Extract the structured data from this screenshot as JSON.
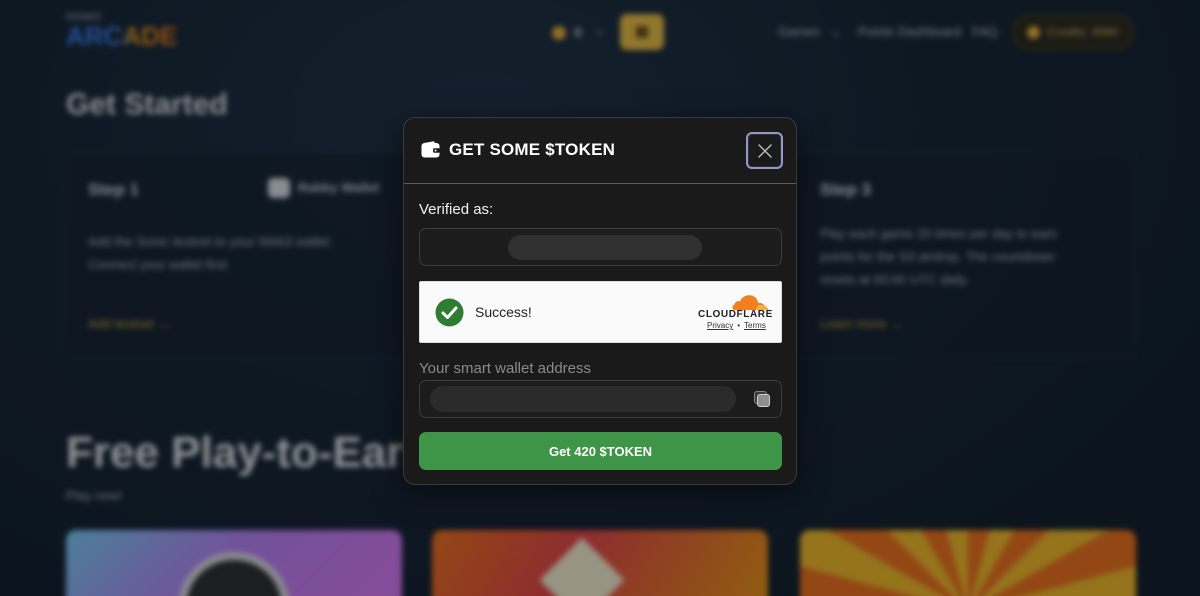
{
  "background": {
    "logo": {
      "small": "SONIC",
      "big": "ARCADE"
    },
    "header": {
      "token_count": "0",
      "nav": [
        "Games",
        "Points Dashboard",
        "FAQ"
      ],
      "points_label": "Credits: 4990"
    },
    "get_started": {
      "title": "Get Started",
      "steps": [
        {
          "title": "Step 1",
          "wallet_name": "Rabby Wallet",
          "text_1": "Add the Sonic testnet to your Web3 wallet.",
          "text_2": "Connect your wallet first",
          "link": "Add testnet →"
        },
        {
          "title": "Step 3",
          "text_1": "Play each game 20 times per day to earn",
          "text_2": "points for the S3 airdrop. The countdown",
          "text_3": "resets at 00:00 UTC daily.",
          "link": "Learn more →"
        }
      ]
    },
    "free_play": {
      "title": "Free Play-to-Earn",
      "subtitle": "Play now!"
    }
  },
  "modal": {
    "title": "GET SOME $TOKEN",
    "verified_label": "Verified as:",
    "captcha": {
      "status": "Success!",
      "brand": "CLOUDFLARE",
      "privacy": "Privacy",
      "separator": "•",
      "terms": "Terms"
    },
    "wallet_label": "Your smart wallet address",
    "submit_label": "Get 420 $TOKEN"
  },
  "colors": {
    "modal_bg": "#1a1a1a",
    "submit_green": "#3f9547",
    "check_green": "#2e7d32",
    "cloudflare_orange": "#f38020",
    "accent_gold": "#f5c542"
  },
  "icons": {
    "title": "wallet-icon",
    "close": "close-icon",
    "captcha": "check-circle-icon",
    "copy": "copy-icon",
    "brand": "cloudflare-cloud-icon"
  }
}
